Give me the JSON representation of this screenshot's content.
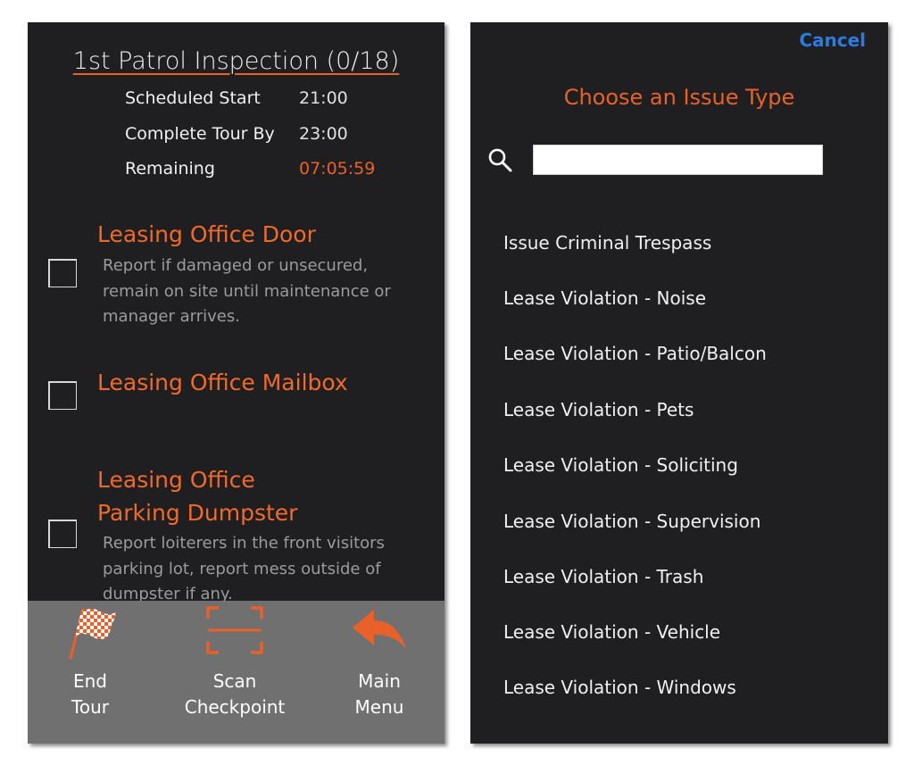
{
  "left_screen": {
    "tour_title": "1st Patrol Inspection (0/18)",
    "info": [
      {
        "label": "Scheduled Start",
        "value": "21:00"
      },
      {
        "label": "Complete Tour By",
        "value": "23:00"
      },
      {
        "label": "Remaining",
        "value": "07:05:59"
      }
    ],
    "checkpoints": [
      {
        "title": "Leasing Office Door",
        "description": "Report if damaged or unsecured, remain on site until maintenance or manager arrives.",
        "checked": false
      },
      {
        "title": "Leasing Office Mailbox",
        "description": "",
        "checked": false
      },
      {
        "title_line1": "Leasing Office",
        "title_line2": "Parking Dumpster",
        "description": "Report loiterers in the front visitors parking lot, report mess outside of dumpster if any.",
        "checked": false
      }
    ],
    "toolbar": {
      "end_tour": {
        "line1": "End",
        "line2": "Tour",
        "icon": "checkered-flag-icon"
      },
      "scan": {
        "line1": "Scan",
        "line2": "Checkpoint",
        "icon": "scan-frame-icon"
      },
      "main_menu": {
        "line1": "Main",
        "line2": "Menu",
        "icon": "back-arrow-icon"
      }
    }
  },
  "right_screen": {
    "cancel_label": "Cancel",
    "heading": "Choose an Issue Type",
    "search": {
      "value": "",
      "placeholder": "",
      "icon": "search-icon"
    },
    "issue_types": [
      "Issue Criminal Trespass",
      "Lease Violation - Noise",
      "Lease Violation - Patio/Balcon",
      "Lease Violation - Pets",
      "Lease Violation - Soliciting",
      "Lease Violation - Supervision",
      "Lease Violation - Trash",
      "Lease Violation - Vehicle",
      "Lease Violation - Windows"
    ]
  },
  "colors": {
    "screen_bg": "#1f1f22",
    "accent_orange": "#e8612a",
    "toolbar_bg": "#707070",
    "cancel_blue": "#2c7be5",
    "description_gray": "#9b9b9b"
  }
}
